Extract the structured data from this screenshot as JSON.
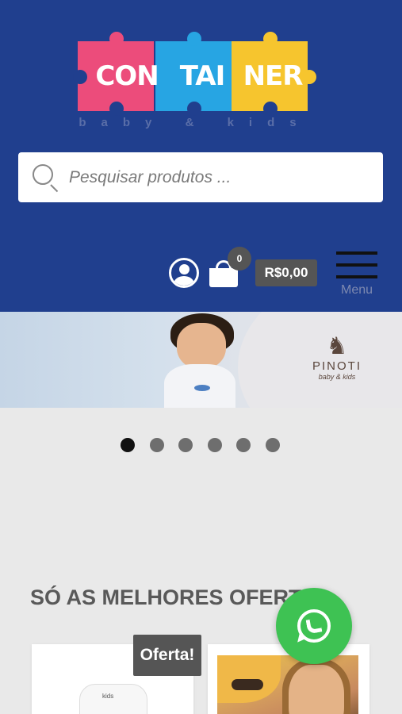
{
  "header": {
    "logo": {
      "words": [
        "CON",
        "TAI",
        "NER"
      ],
      "tagline": "baby & kids",
      "colors": [
        "#ec4c7b",
        "#27a5e3",
        "#f6c52e"
      ]
    },
    "background": "#203f8e",
    "search": {
      "placeholder": "Pesquisar produtos ...",
      "icon": "search-icon"
    },
    "account": {
      "icon": "user-icon"
    },
    "cart": {
      "icon": "shopping-bag-icon",
      "count": "0",
      "total": "R$0,00"
    },
    "menu": {
      "icon": "hamburger-icon",
      "label": "Menu"
    }
  },
  "banner": {
    "brand": {
      "name": "PINOTI",
      "sub": "baby & kids",
      "icon": "rocking-horse-icon"
    }
  },
  "slider": {
    "slide_count": 6,
    "active_index": 0
  },
  "section": {
    "title": "SÓ AS MELHORES OFERTAS",
    "products": [
      {
        "badge": "Oferta!",
        "image": "baby-onesie",
        "image_text": "kids"
      },
      {
        "image": "girl-photo"
      }
    ]
  },
  "whatsapp": {
    "icon": "whatsapp-icon",
    "color": "#3ec253"
  }
}
